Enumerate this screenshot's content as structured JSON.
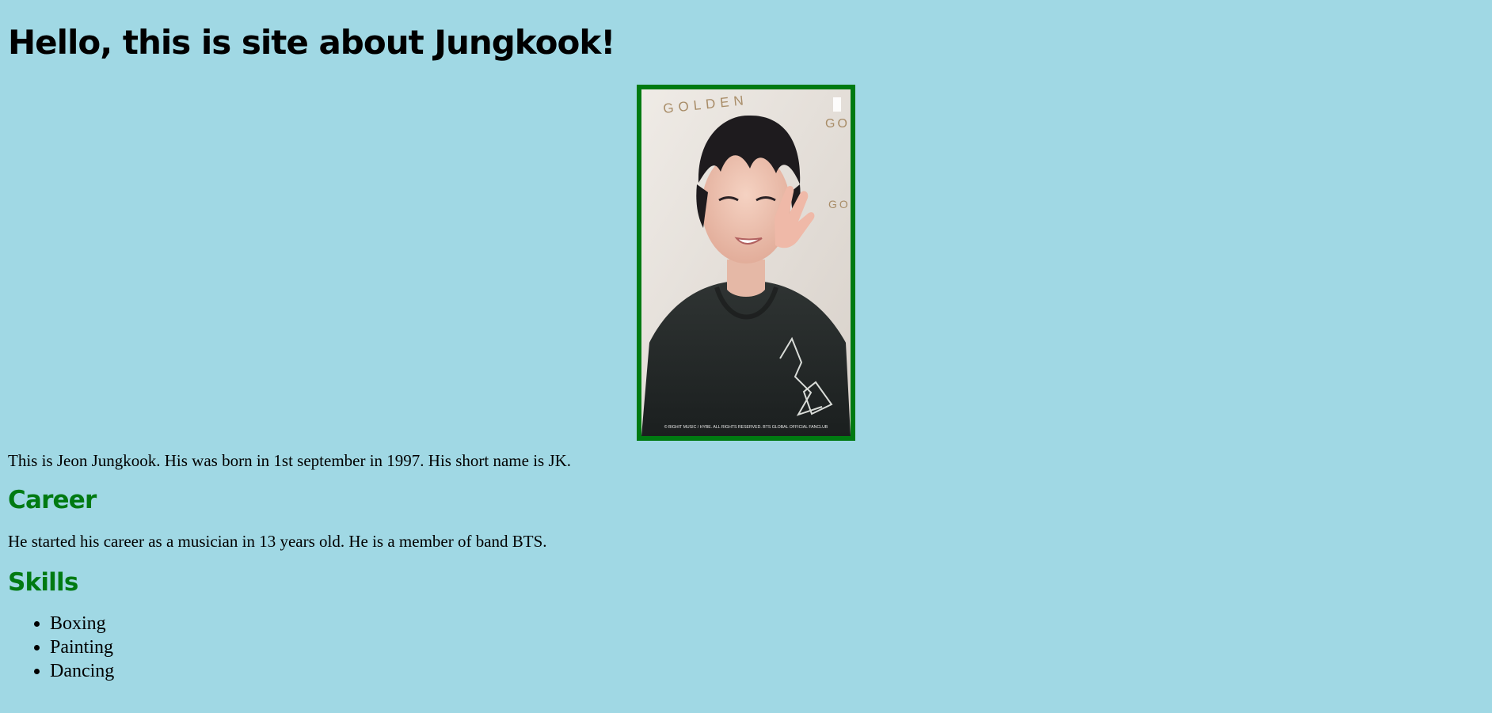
{
  "page": {
    "title": "Hello, this is site about Jungkook!",
    "photo_alt": "Jungkook",
    "photo_text_top": "GOLDEN",
    "photo_text_side": "GO",
    "photo_caption": "© BIGHIT MUSIC / HYBE. ALL RIGHTS RESERVED. BTS GLOBAL OFFICIAL FANCLUB",
    "intro": "This is Jeon Jungkook. His was born in 1st september in 1997. His short name is JK.",
    "career": {
      "title": "Career",
      "text": "He started his career as a musician in 13 years old. He is a member of band BTS."
    },
    "skills": {
      "title": "Skills",
      "items": [
        "Boxing",
        "Painting",
        "Dancing"
      ]
    }
  },
  "colors": {
    "background": "#a0d8e4",
    "heading_accent": "#007a12",
    "photo_border": "#007a12",
    "text": "#000000"
  }
}
